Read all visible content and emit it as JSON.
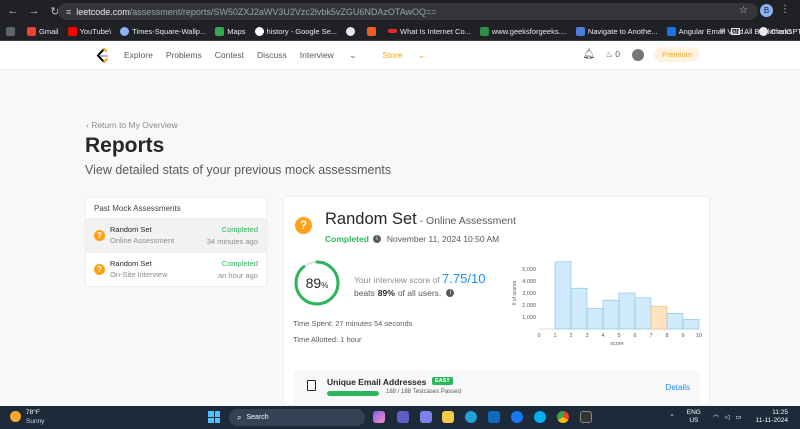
{
  "browser": {
    "url_domain": "leetcode.com",
    "url_path": "/assessment/reports/SW50ZXJ2aWV3U2Vzc2lvbk5vZGU6NDAzOTAwOQ==",
    "profile_initial": "B",
    "bookmarks": [
      "Gmail",
      "YouTube\\",
      "Times-Square-Wallp...",
      "Maps",
      "history - Google Se...",
      "What Is Internet Co...",
      "www.geeksforgeeks....",
      "Navigate to Anothe...",
      "Angular Email Valid...",
      "ChatGPT"
    ],
    "all_bookmarks": "All Bookmarks"
  },
  "nav": {
    "links": [
      "Explore",
      "Problems",
      "Contest",
      "Discuss",
      "Interview",
      "Store"
    ],
    "streak": "0",
    "premium": "Premium"
  },
  "page": {
    "back": "‹ Return to My Overview",
    "title": "Reports",
    "subtitle": "View detailed stats of your previous mock assessments"
  },
  "past": {
    "heading": "Past Mock Assessments",
    "items": [
      {
        "title": "Random Set",
        "type": "Online Assessment",
        "status": "Completed",
        "time": "34 minutes ago"
      },
      {
        "title": "Random Set",
        "type": "On-Site Interview",
        "status": "Completed",
        "time": "an hour ago"
      }
    ]
  },
  "report": {
    "title": "Random Set",
    "subtitle": " - Online Assessment",
    "status": "Completed",
    "date": "November 11, 2024 10:50 AM",
    "percent": "89",
    "percent_value": 0.89,
    "percent_unit": "%",
    "score_prefix": "Your interview score of ",
    "score": "7.75/10",
    "beats_prefix": "beats",
    "beats_value": "89%",
    "beats_suffix": "of all users.",
    "time_spent": "Time Spent: 27 minutes 54 seconds",
    "time_allotted": "Time Allotted: 1 hour",
    "question": {
      "name": "Unique Email Addresses",
      "difficulty": "EASY",
      "progress": 1.0,
      "passed": "188 / 188 Testcases Passed",
      "details": "Details"
    }
  },
  "chart_data": {
    "type": "bar",
    "x": [
      1,
      2,
      3,
      4,
      5,
      6,
      7,
      8,
      9
    ],
    "values": [
      5600,
      3400,
      1700,
      2400,
      3000,
      2600,
      1900,
      1300,
      800
    ],
    "highlight_index": 6,
    "xticks": [
      "0",
      "1",
      "2",
      "3",
      "4",
      "5",
      "6",
      "7",
      "8",
      "9",
      "10"
    ],
    "yticks": [
      "1,000",
      "2,000",
      "3,000",
      "4,000",
      "5,000"
    ],
    "xlabel": "score",
    "ylabel": "# of scores",
    "ylim": [
      0,
      6000
    ],
    "xlim": [
      0,
      10
    ],
    "colors": {
      "bar": "#d1eafb",
      "bar_stroke": "#7cc1ef",
      "highlight": "#fde3c0",
      "highlight_stroke": "#f5b76a"
    }
  },
  "taskbar": {
    "temp": "78°F",
    "condition": "Sunny",
    "search": "Search",
    "lang1": "ENG",
    "lang2": "US",
    "time": "11:25",
    "date": "11-11-2024"
  }
}
